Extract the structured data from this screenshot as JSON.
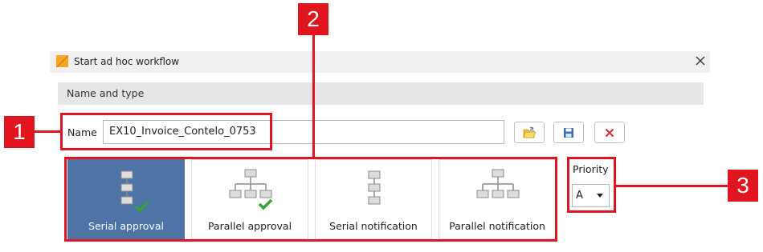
{
  "window": {
    "title": "Start ad hoc workflow",
    "close_icon": "close-icon"
  },
  "section": {
    "header": "Name and type"
  },
  "name_field": {
    "label": "Name",
    "value": "EX10_Invoice_Contelo_0753"
  },
  "toolbar": {
    "buttons": [
      {
        "icon": "folder-open-icon"
      },
      {
        "icon": "save-icon"
      },
      {
        "icon": "delete-x-icon"
      }
    ]
  },
  "workflow_types": [
    {
      "label": "Serial approval",
      "selected": true,
      "icon": "serial-approval-icon"
    },
    {
      "label": "Parallel approval",
      "selected": false,
      "icon": "parallel-approval-icon"
    },
    {
      "label": "Serial notification",
      "selected": false,
      "icon": "serial-notification-icon"
    },
    {
      "label": "Parallel notification",
      "selected": false,
      "icon": "parallel-notification-icon"
    }
  ],
  "priority": {
    "label": "Priority",
    "value": "A"
  },
  "callouts": [
    {
      "number": "1"
    },
    {
      "number": "2"
    },
    {
      "number": "3"
    }
  ],
  "colors": {
    "accent_selected": "#4e73a6",
    "callout_red": "#e0151f",
    "check_green": "#3aa335",
    "delete_red": "#d92b2b"
  }
}
